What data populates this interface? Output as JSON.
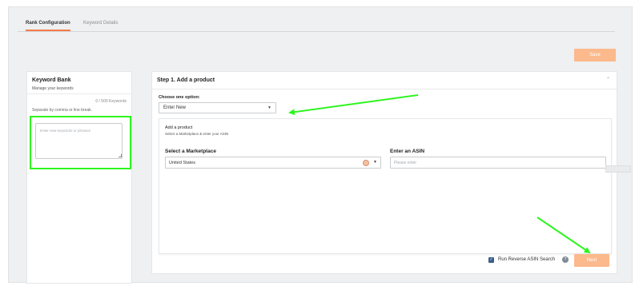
{
  "tabs": [
    {
      "label": "Rank Configuration",
      "active": true
    },
    {
      "label": "Keyword Details",
      "active": false
    }
  ],
  "toolbar": {
    "save_label": "Save"
  },
  "keyword_bank": {
    "title": "Keyword Bank",
    "subtitle": "Manage your keywords",
    "count": "0 / 500 Keywords",
    "hint": "Separate by comma or line break.",
    "placeholder": "Enter new keywords or phrases"
  },
  "step": {
    "title": "Step 1. Add a product",
    "choose_label": "Choose one option:",
    "choose_value": "Enter New",
    "add_title": "Add a product",
    "add_subtitle": "Select a Marketplace & enter your ASIN",
    "marketplace_label": "Select a Marketplace",
    "marketplace_value": "United States",
    "asin_label": "Enter an ASIN",
    "asin_placeholder": "Please enter"
  },
  "footer": {
    "reverse_label": "Run Reverse ASIN Search",
    "reverse_checked": true,
    "next_label": "Next"
  },
  "colors": {
    "accent": "#f47b46",
    "button": "#fbb98c",
    "annotation": "#2ef51f"
  }
}
